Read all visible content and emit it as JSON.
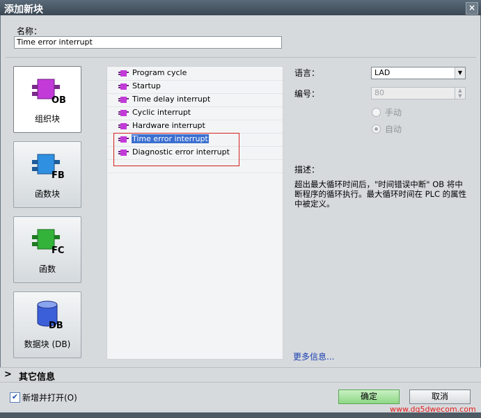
{
  "window": {
    "title": "添加新块",
    "close_glyph": "×"
  },
  "name_field": {
    "label": "名称：",
    "value": "Time error interrupt"
  },
  "block_types": [
    {
      "id": "OB",
      "label": "组织块",
      "badge": "OB",
      "color": "#c23ad8",
      "selected": true
    },
    {
      "id": "FB",
      "label": "函数块",
      "badge": "FB",
      "color": "#2f8fe0",
      "selected": false
    },
    {
      "id": "FC",
      "label": "函数",
      "badge": "FC",
      "color": "#34b33a",
      "selected": false
    },
    {
      "id": "DB",
      "label": "数据块 (DB)",
      "badge": "DB",
      "color": "#3b5fd8",
      "selected": false
    }
  ],
  "ob_list": [
    {
      "label": "Program cycle",
      "selected": false
    },
    {
      "label": "Startup",
      "selected": false
    },
    {
      "label": "Time delay interrupt",
      "selected": false
    },
    {
      "label": "Cyclic interrupt",
      "selected": false
    },
    {
      "label": "Hardware interrupt",
      "selected": false
    },
    {
      "label": "Time error interrupt",
      "selected": true
    },
    {
      "label": "Diagnostic error interrupt",
      "selected": false
    }
  ],
  "properties": {
    "language_label": "语言：",
    "language_value": "LAD",
    "number_label": "编号：",
    "number_value": "80",
    "manual_label": "手动",
    "auto_label": "自动",
    "auto_selected": true
  },
  "description": {
    "label": "描述：",
    "text": "超出最大循环时间后，\"时间错误中断\" OB 将中断程序的循环执行。最大循环时间在 PLC 的属性中被定义。"
  },
  "more_info": "更多信息...",
  "other_info": {
    "chevron": ">",
    "label": "其它信息"
  },
  "footer": {
    "add_open_checked": true,
    "add_open_label": "新增并打开(O)",
    "ok_label": "确定",
    "cancel_label": "取消",
    "watermark": "www.dq5dwecom.com"
  }
}
